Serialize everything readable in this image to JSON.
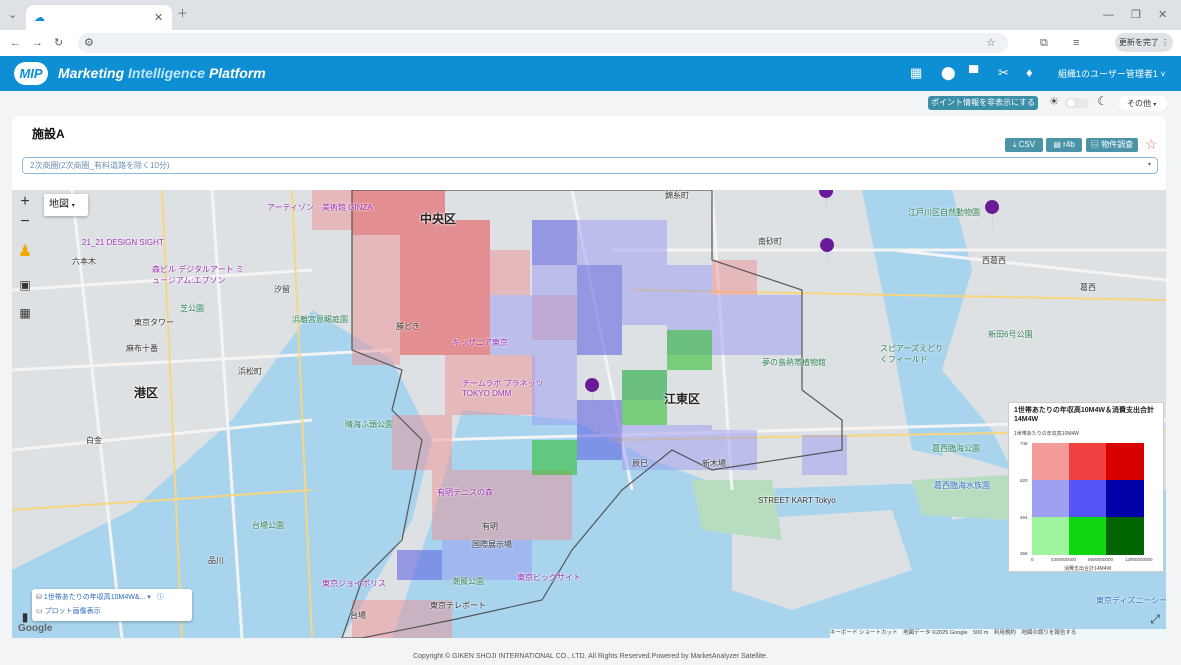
{
  "browser": {
    "tab_title": "",
    "update_button": "更新を完了"
  },
  "header": {
    "logo": "MIP",
    "title_part1": "Marketing",
    "title_part2": "Intelligence",
    "title_part3": "Platform",
    "user_menu": "組織1のユーザー管理者1 ˅"
  },
  "subbar": {
    "point_toggle": "ポイント情報を非表示にする",
    "other_select": "その他"
  },
  "panel": {
    "facility_title": "施設A",
    "csv_button": "⤓ CSV",
    "rab_button": "r4b",
    "property_button": "物件調査",
    "area_select": "2次商圏(2次商圏_有料道路を除く10分)"
  },
  "map": {
    "maptype": "地図",
    "labels": {
      "chuo": "中央区",
      "minato": "港区",
      "koto": "江東区",
      "tokyo_tower": "東京タワー",
      "ginza": "アーティゾン　美術館 GINZA",
      "design_sight": "21_21 DESIGN SIGHT",
      "mori": "森ビル デジタルアート ミュージアム:エプソン",
      "hamarikyu": "浜離宮恩賜庭園",
      "kachidoki": "勝どき",
      "kidzania": "キッザニア東京",
      "teamlab": "チームラボ プラネッツ TOKYO DMM",
      "ariake": "有明テニスの森",
      "tokyo_big_sight": "東京ビッグサイト",
      "kokusai": "国際展示場",
      "harumi": "晴海ふ頭公園",
      "daiba": "台場",
      "joypolis": "東京ジョイポリス",
      "teleport": "東京テレポート",
      "shiokaze": "潮風公園",
      "yumenoshima": "夢の島熱帯植物館",
      "shin_kiba": "新木場",
      "street_kart": "STREET KART Tokyo",
      "kasai_rinkai": "葛西臨海公園",
      "kasai_suizokuen": "葛西臨海水族園",
      "spaceworld": "スピアーズえどりくフィールド",
      "shinden": "新田6号公園",
      "edogawa_zoo": "江戸川区自然動物園",
      "nishikasai": "西葛西",
      "kasai": "葛西",
      "minami_sunamachi": "南砂町",
      "tatsumi": "辰巳",
      "ariake_st": "有明",
      "shiodome": "汐留",
      "hamamatsucho": "浜松町",
      "shiba_park": "芝公園",
      "roppongi": "六本木",
      "azabu": "麻布十番",
      "shirokane": "白金",
      "shinagawa": "品川",
      "odaiba_park": "台場公園",
      "kinshicho": "錦糸町",
      "disney": "東京ディズニーシー"
    },
    "legend": {
      "title": "1世帯あたりの年収高10M4W＆消費支出合計14M4W",
      "ylabel": "1世帯あたりの年収高10M4W",
      "xlabel": "消費支出合計14M4W",
      "y_ticks": [
        "748",
        "620",
        "494",
        "368"
      ],
      "x_ticks": [
        "0",
        "4300000000",
        "8600000000",
        "12900000000"
      ]
    },
    "layers": {
      "row1": "1世帯あたりの年収高10M4W&... ▾",
      "row2": "プロット画像表示"
    },
    "attribution": "キーボード ショートカット　地図データ ©2025 Google　500 m　利用規約　地図の誤りを報告する",
    "google": "Google"
  },
  "footer": "Copyright © GIKEN SHOJI INTERNATIONAL CO., LTD. All Rights Reserved.Powered by MarketAnalyzer Satellite."
}
